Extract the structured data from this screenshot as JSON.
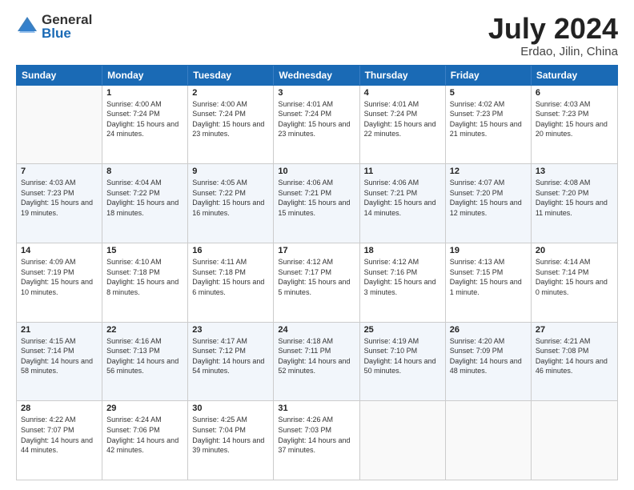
{
  "logo": {
    "general": "General",
    "blue": "Blue"
  },
  "title": {
    "month_year": "July 2024",
    "location": "Erdao, Jilin, China"
  },
  "days_header": [
    "Sunday",
    "Monday",
    "Tuesday",
    "Wednesday",
    "Thursday",
    "Friday",
    "Saturday"
  ],
  "weeks": [
    [
      {
        "day": "",
        "sunrise": "",
        "sunset": "",
        "daylight": ""
      },
      {
        "day": "1",
        "sunrise": "Sunrise: 4:00 AM",
        "sunset": "Sunset: 7:24 PM",
        "daylight": "Daylight: 15 hours and 24 minutes."
      },
      {
        "day": "2",
        "sunrise": "Sunrise: 4:00 AM",
        "sunset": "Sunset: 7:24 PM",
        "daylight": "Daylight: 15 hours and 23 minutes."
      },
      {
        "day": "3",
        "sunrise": "Sunrise: 4:01 AM",
        "sunset": "Sunset: 7:24 PM",
        "daylight": "Daylight: 15 hours and 23 minutes."
      },
      {
        "day": "4",
        "sunrise": "Sunrise: 4:01 AM",
        "sunset": "Sunset: 7:24 PM",
        "daylight": "Daylight: 15 hours and 22 minutes."
      },
      {
        "day": "5",
        "sunrise": "Sunrise: 4:02 AM",
        "sunset": "Sunset: 7:23 PM",
        "daylight": "Daylight: 15 hours and 21 minutes."
      },
      {
        "day": "6",
        "sunrise": "Sunrise: 4:03 AM",
        "sunset": "Sunset: 7:23 PM",
        "daylight": "Daylight: 15 hours and 20 minutes."
      }
    ],
    [
      {
        "day": "7",
        "sunrise": "Sunrise: 4:03 AM",
        "sunset": "Sunset: 7:23 PM",
        "daylight": "Daylight: 15 hours and 19 minutes."
      },
      {
        "day": "8",
        "sunrise": "Sunrise: 4:04 AM",
        "sunset": "Sunset: 7:22 PM",
        "daylight": "Daylight: 15 hours and 18 minutes."
      },
      {
        "day": "9",
        "sunrise": "Sunrise: 4:05 AM",
        "sunset": "Sunset: 7:22 PM",
        "daylight": "Daylight: 15 hours and 16 minutes."
      },
      {
        "day": "10",
        "sunrise": "Sunrise: 4:06 AM",
        "sunset": "Sunset: 7:21 PM",
        "daylight": "Daylight: 15 hours and 15 minutes."
      },
      {
        "day": "11",
        "sunrise": "Sunrise: 4:06 AM",
        "sunset": "Sunset: 7:21 PM",
        "daylight": "Daylight: 15 hours and 14 minutes."
      },
      {
        "day": "12",
        "sunrise": "Sunrise: 4:07 AM",
        "sunset": "Sunset: 7:20 PM",
        "daylight": "Daylight: 15 hours and 12 minutes."
      },
      {
        "day": "13",
        "sunrise": "Sunrise: 4:08 AM",
        "sunset": "Sunset: 7:20 PM",
        "daylight": "Daylight: 15 hours and 11 minutes."
      }
    ],
    [
      {
        "day": "14",
        "sunrise": "Sunrise: 4:09 AM",
        "sunset": "Sunset: 7:19 PM",
        "daylight": "Daylight: 15 hours and 10 minutes."
      },
      {
        "day": "15",
        "sunrise": "Sunrise: 4:10 AM",
        "sunset": "Sunset: 7:18 PM",
        "daylight": "Daylight: 15 hours and 8 minutes."
      },
      {
        "day": "16",
        "sunrise": "Sunrise: 4:11 AM",
        "sunset": "Sunset: 7:18 PM",
        "daylight": "Daylight: 15 hours and 6 minutes."
      },
      {
        "day": "17",
        "sunrise": "Sunrise: 4:12 AM",
        "sunset": "Sunset: 7:17 PM",
        "daylight": "Daylight: 15 hours and 5 minutes."
      },
      {
        "day": "18",
        "sunrise": "Sunrise: 4:12 AM",
        "sunset": "Sunset: 7:16 PM",
        "daylight": "Daylight: 15 hours and 3 minutes."
      },
      {
        "day": "19",
        "sunrise": "Sunrise: 4:13 AM",
        "sunset": "Sunset: 7:15 PM",
        "daylight": "Daylight: 15 hours and 1 minute."
      },
      {
        "day": "20",
        "sunrise": "Sunrise: 4:14 AM",
        "sunset": "Sunset: 7:14 PM",
        "daylight": "Daylight: 15 hours and 0 minutes."
      }
    ],
    [
      {
        "day": "21",
        "sunrise": "Sunrise: 4:15 AM",
        "sunset": "Sunset: 7:14 PM",
        "daylight": "Daylight: 14 hours and 58 minutes."
      },
      {
        "day": "22",
        "sunrise": "Sunrise: 4:16 AM",
        "sunset": "Sunset: 7:13 PM",
        "daylight": "Daylight: 14 hours and 56 minutes."
      },
      {
        "day": "23",
        "sunrise": "Sunrise: 4:17 AM",
        "sunset": "Sunset: 7:12 PM",
        "daylight": "Daylight: 14 hours and 54 minutes."
      },
      {
        "day": "24",
        "sunrise": "Sunrise: 4:18 AM",
        "sunset": "Sunset: 7:11 PM",
        "daylight": "Daylight: 14 hours and 52 minutes."
      },
      {
        "day": "25",
        "sunrise": "Sunrise: 4:19 AM",
        "sunset": "Sunset: 7:10 PM",
        "daylight": "Daylight: 14 hours and 50 minutes."
      },
      {
        "day": "26",
        "sunrise": "Sunrise: 4:20 AM",
        "sunset": "Sunset: 7:09 PM",
        "daylight": "Daylight: 14 hours and 48 minutes."
      },
      {
        "day": "27",
        "sunrise": "Sunrise: 4:21 AM",
        "sunset": "Sunset: 7:08 PM",
        "daylight": "Daylight: 14 hours and 46 minutes."
      }
    ],
    [
      {
        "day": "28",
        "sunrise": "Sunrise: 4:22 AM",
        "sunset": "Sunset: 7:07 PM",
        "daylight": "Daylight: 14 hours and 44 minutes."
      },
      {
        "day": "29",
        "sunrise": "Sunrise: 4:24 AM",
        "sunset": "Sunset: 7:06 PM",
        "daylight": "Daylight: 14 hours and 42 minutes."
      },
      {
        "day": "30",
        "sunrise": "Sunrise: 4:25 AM",
        "sunset": "Sunset: 7:04 PM",
        "daylight": "Daylight: 14 hours and 39 minutes."
      },
      {
        "day": "31",
        "sunrise": "Sunrise: 4:26 AM",
        "sunset": "Sunset: 7:03 PM",
        "daylight": "Daylight: 14 hours and 37 minutes."
      },
      {
        "day": "",
        "sunrise": "",
        "sunset": "",
        "daylight": ""
      },
      {
        "day": "",
        "sunrise": "",
        "sunset": "",
        "daylight": ""
      },
      {
        "day": "",
        "sunrise": "",
        "sunset": "",
        "daylight": ""
      }
    ]
  ]
}
